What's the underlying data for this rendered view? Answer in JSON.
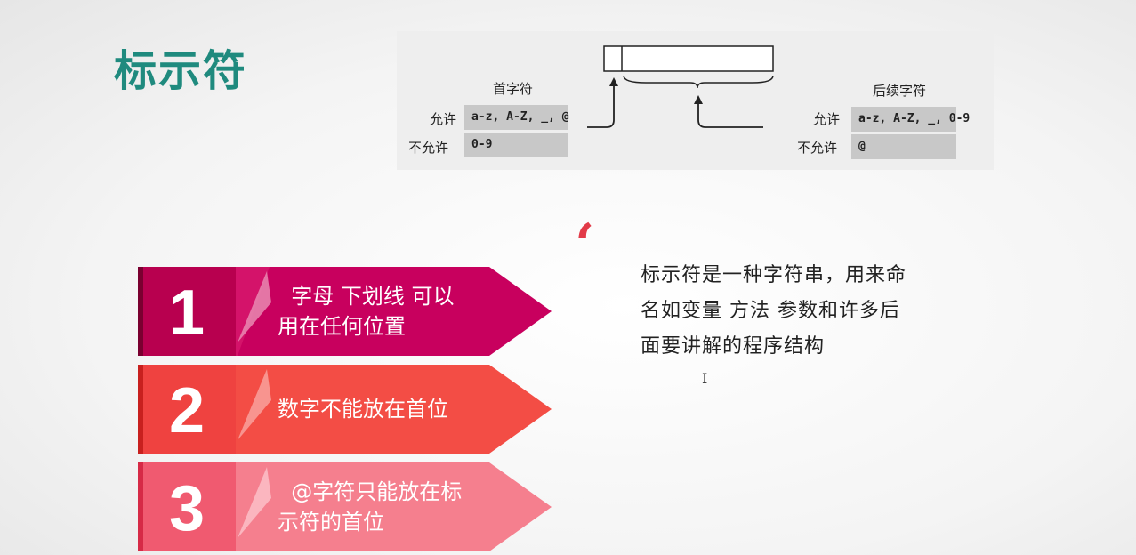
{
  "title": "标示符",
  "diagram": {
    "first_char_label": "首字符",
    "following_chars_label": "后续字符",
    "allow_label": "允许",
    "disallow_label": "不允许",
    "first_allow": "a-z, A-Z, _, @",
    "first_disallow": "0-9",
    "following_allow": "a-z, A-Z, _, 0-9",
    "following_disallow": "@"
  },
  "items": [
    {
      "number": "1",
      "line1": "  字母 下划线 可以",
      "line2": "用在任何位置",
      "color": "#c8005e"
    },
    {
      "number": "2",
      "line1": "数字不能放在首位",
      "line2": "",
      "color": "#f34d45"
    },
    {
      "number": "3",
      "line1": "  @字符只能放在标",
      "line2": "示符的首位",
      "color": "#f26a7e"
    }
  ],
  "quote_mark": "‘",
  "description": "标示符是一种字符串，用来命名如变量 方法 参数和许多后面要讲解的程序结构",
  "cursor_glyph": "I"
}
